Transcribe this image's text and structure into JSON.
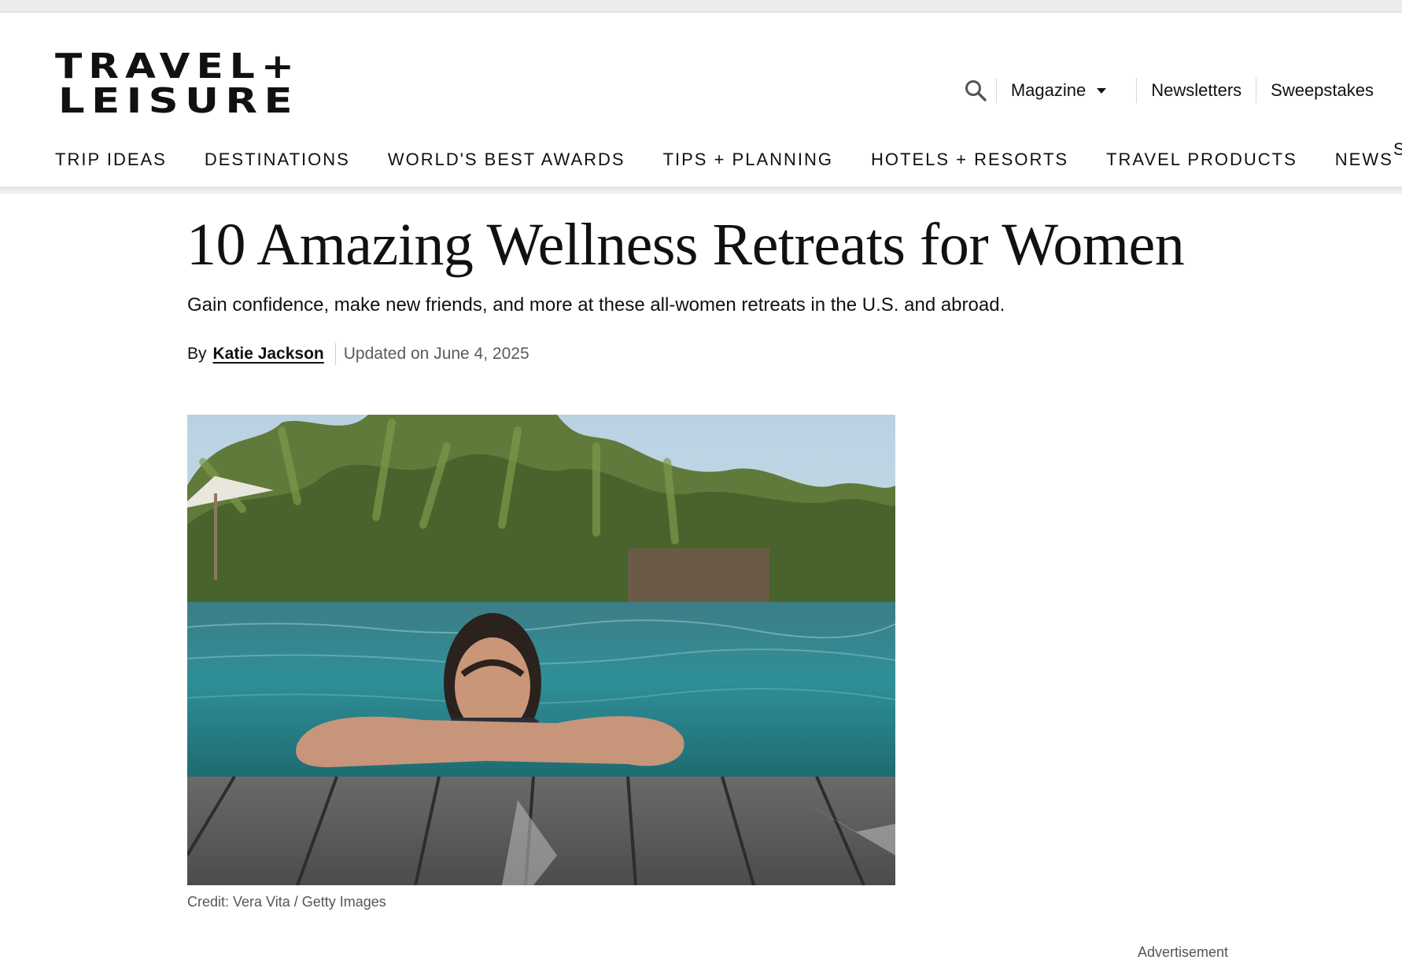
{
  "brand": {
    "logo_line1": "TRAVEL+",
    "logo_line2": "LEISURE"
  },
  "utility_nav": {
    "search_icon": "search-icon",
    "magazine_label": "Magazine",
    "magazine_icon": "caret-down-icon",
    "newsletters_label": "Newsletters",
    "sweepstakes_label": "Sweepstakes"
  },
  "main_nav": {
    "items": [
      {
        "label": "TRIP IDEAS"
      },
      {
        "label": "DESTINATIONS"
      },
      {
        "label": "WORLD'S BEST AWARDS"
      },
      {
        "label": "TIPS + PLANNING"
      },
      {
        "label": "HOTELS + RESORTS"
      },
      {
        "label": "TRAVEL PRODUCTS"
      },
      {
        "label": "NEWS"
      }
    ],
    "overflow_label": "S"
  },
  "article": {
    "title": "10 Amazing Wellness Retreats for Women",
    "dek": "Gain confidence, make new friends, and more at these all-women retreats in the U.S. and abroad.",
    "byline_prefix": "By",
    "author": "Katie Jackson",
    "updated": "Updated on June 4, 2025",
    "image_credit": "Credit: Vera Vita / Getty Images"
  },
  "advertisement_label": "Advertisement",
  "colors": {
    "text": "#111111",
    "muted": "#5a5a5a",
    "divider": "#d6d6d6"
  }
}
